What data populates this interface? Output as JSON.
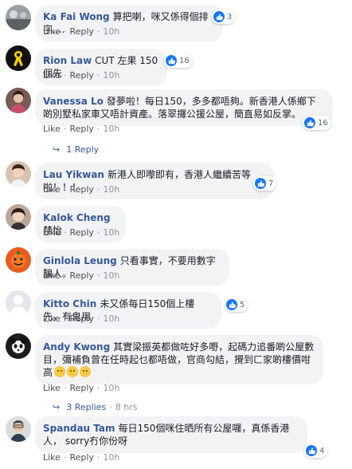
{
  "ui": {
    "like_label": "Like",
    "reply_label": "Reply",
    "dot": "·"
  },
  "comments": [
    {
      "name": "Ka Fai Wong",
      "text": "算把喇，咪又係得個排字....",
      "time": "10h",
      "likes": "3"
    },
    {
      "name": "Rion Law",
      "text": "CUT 左果 150 個先",
      "time": "10h",
      "likes": "16"
    },
    {
      "name": "Vanessa Lo",
      "text": "發夢啦！每日150，多多都唔夠。新香港人係鄉下啲別墅私家車又唔計資產。落翠攞公援公屋，簡直易如反掌。",
      "time": "10h",
      "likes": "16",
      "replies": {
        "label": "1 Reply"
      }
    },
    {
      "name": "Lau Yikwan",
      "text": "新港人即嚟即有，香港人繼續苦等啦！！！",
      "time": "10h",
      "likes": "7"
    },
    {
      "name": "Kalok Cheng",
      "text": "禁怡",
      "time": "10h"
    },
    {
      "name": "Ginlola Leung",
      "text": "只看事實，不要用數字騙人。",
      "time": "10h"
    },
    {
      "name": "Kitto Chin",
      "text": "未又係每日150個上樓先，有鬼用",
      "time": "10h",
      "likes": "5"
    },
    {
      "name": "Andy Kwong",
      "text": "其實梁振英都做咗好多嘢，起碼力追番啲公屋數目，彌補負曾在任時起乜都唔做，官商勾結，攪到ㄈ家啲樓價咁高",
      "time": "10h",
      "replies": {
        "label": "3 Replies",
        "time": "8 hrs"
      }
    },
    {
      "name": "Spandau Tam",
      "text": "每日150個咪住晒所有公屋囉，真係香港人， sorry冇你份呀",
      "time": "10h",
      "likes": "4"
    }
  ],
  "colors": {
    "name": "#385898",
    "bubble": "#f2f3f5",
    "like": "#1877f2",
    "meta": "#90949c"
  }
}
